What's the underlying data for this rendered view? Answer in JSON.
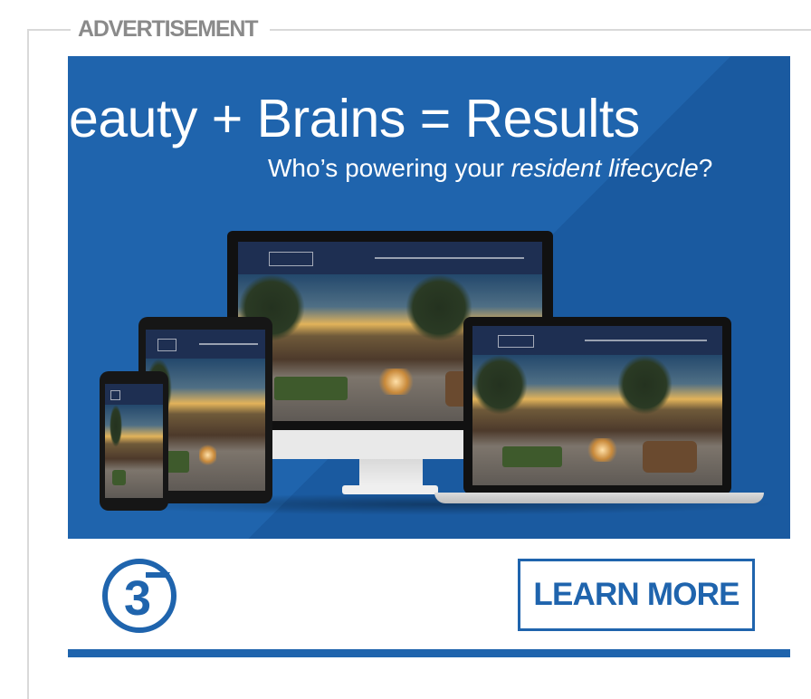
{
  "frame": {
    "legend_label": "ADVERTISEMENT"
  },
  "ad": {
    "headline": "Beauty + Brains = Results",
    "subline_prefix": "Who’s powering your ",
    "subline_emphasis": "resident lifecycle",
    "subline_suffix": "?",
    "cta_label": "LEARN MORE",
    "brand_mark_label": "3",
    "colors": {
      "brand_blue": "#1f64ad",
      "legend_gray": "#8a8a8a"
    }
  }
}
